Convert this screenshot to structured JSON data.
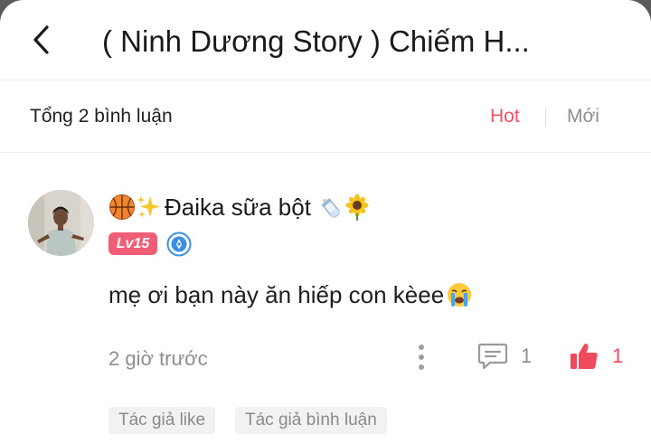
{
  "header": {
    "title": "( Ninh Dương Story ) Chiếm H..."
  },
  "comments_bar": {
    "total_label": "Tổng 2 bình luận",
    "sort_hot": "Hot",
    "sort_new": "Mới",
    "active_sort": "Hot"
  },
  "comment": {
    "username": "Đaika sữa bột",
    "level": "Lv15",
    "text": "mẹ ơi bạn này ăn hiếp con kèee",
    "time": "2 giờ trước",
    "reply_count": "1",
    "like_count": "1",
    "liked": true,
    "tags": [
      "Tác giả like",
      "Tác giả bình luận"
    ]
  },
  "icons": {
    "back": "back-arrow-icon",
    "username_emojis": [
      "basketball-icon",
      "sparkles-icon",
      "baby-bottle-icon",
      "sunflower-icon"
    ],
    "verify": "verified-badge-icon",
    "text_emoji": "crying-face-icon",
    "more": "more-vertical-icon",
    "reply": "comment-bubble-icon",
    "like": "thumbs-up-icon"
  },
  "colors": {
    "accent": "#ef5266",
    "level_badge": "#ef5e76",
    "verify_badge": "#3a8ee6",
    "muted_text": "#8e8e8e"
  }
}
